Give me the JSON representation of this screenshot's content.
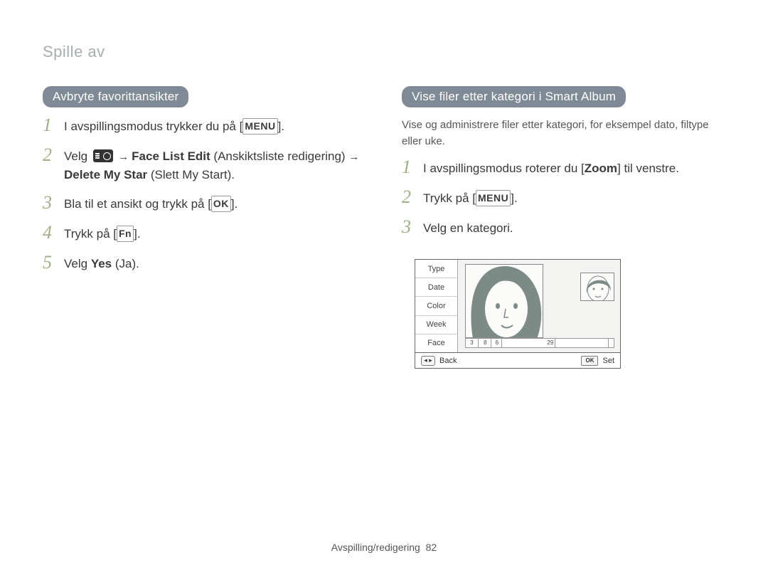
{
  "header": "Spille av",
  "left": {
    "heading": "Avbryte favorittansikter",
    "steps": [
      {
        "pre": "I avspillingsmodus trykker du på [",
        "btn": "MENU",
        "post": "]."
      },
      {
        "text1": "Velg ",
        "arrow": " → ",
        "b1": "Face List Edit",
        "p1": " (Anskiktsliste redigering) ",
        "b2": "Delete My Star",
        "p2": " (Slett My Start)."
      },
      {
        "pre": "Bla til et ansikt og trykk på [",
        "btn": "OK",
        "post": "]."
      },
      {
        "pre": "Trykk på [",
        "btn": "Fn",
        "post": "]."
      },
      {
        "text1": "Velg ",
        "b1": "Yes",
        "p1": " (Ja)."
      }
    ]
  },
  "right": {
    "heading": "Vise filer etter kategori i Smart Album",
    "lead": "Vise og administrere filer etter kategori, for eksempel dato, filtype eller uke.",
    "steps": [
      {
        "pre": "I avspillingsmodus roterer du [",
        "bold": "Zoom",
        "post": "] til venstre."
      },
      {
        "pre": "Trykk på [",
        "btn": "MENU",
        "post": "]."
      },
      {
        "plain": "Velg en kategori."
      }
    ],
    "camera": {
      "categories": [
        "Type",
        "Date",
        "Color",
        "Week",
        "Face"
      ],
      "timeline": {
        "labels": [
          "3",
          "8",
          "6",
          "29"
        ]
      },
      "footer": {
        "back": "Back",
        "ok": "OK",
        "set": "Set"
      }
    }
  },
  "footer": {
    "section": "Avspilling/redigering",
    "page": "82"
  }
}
